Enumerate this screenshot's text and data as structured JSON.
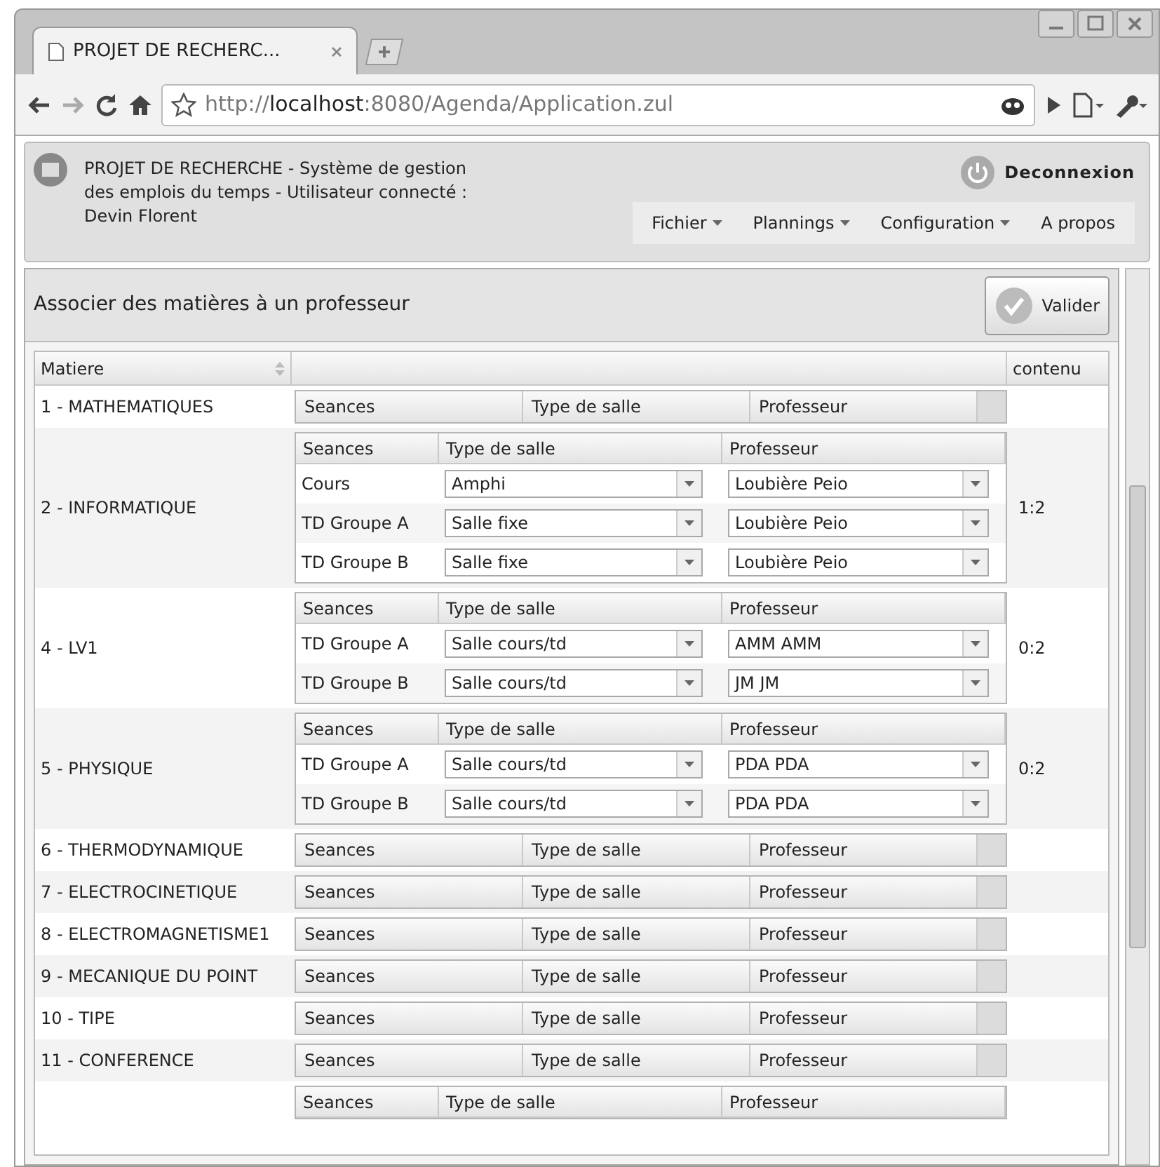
{
  "browser": {
    "tab_title": "PROJET DE RECHERC...",
    "url": "http://**localhost**:8080/Agenda/Application.zul"
  },
  "header": {
    "title": "PROJET DE RECHERCHE - Système de gestion des emplois du temps - Utilisateur connecté : Devin Florent",
    "logout": "Deconnexion",
    "menu": [
      {
        "label": "Fichier",
        "dropdown": true
      },
      {
        "label": "Plannings",
        "dropdown": true
      },
      {
        "label": "Configuration",
        "dropdown": true
      },
      {
        "label": "A propos",
        "dropdown": false
      }
    ]
  },
  "panel": {
    "title": "Associer des matières à un professeur",
    "submit": "Valider"
  },
  "table": {
    "columns": [
      "Matiere",
      "",
      "contenu"
    ],
    "rows": [
      {
        "name": "1 - MATHEMATIQUES",
        "kind": "empty",
        "header": [
          "Seances",
          "Type de salle",
          "Professeur"
        ],
        "sessions": [],
        "contenu": ""
      },
      {
        "name": "2 - INFORMATIQUE",
        "kind": "filled",
        "header": [
          "Seances",
          "Type de salle",
          "Professeur"
        ],
        "sessions": [
          {
            "seance": "Cours",
            "room": "Amphi",
            "teacher": "Loubière Peio"
          },
          {
            "seance": "TD Groupe A",
            "room": "Salle fixe",
            "teacher": "Loubière Peio"
          },
          {
            "seance": "TD Groupe B",
            "room": "Salle fixe",
            "teacher": "Loubière Peio"
          }
        ],
        "contenu": "1:2"
      },
      {
        "name": "4 - LV1",
        "kind": "filled",
        "header": [
          "Seances",
          "Type de salle",
          "Professeur"
        ],
        "sessions": [
          {
            "seance": "TD Groupe A",
            "room": "Salle cours/td",
            "teacher": "AMM AMM"
          },
          {
            "seance": "TD Groupe B",
            "room": "Salle cours/td",
            "teacher": "JM JM"
          }
        ],
        "contenu": "0:2"
      },
      {
        "name": "5 - PHYSIQUE",
        "kind": "filled",
        "header": [
          "Seances",
          "Type de salle",
          "Professeur"
        ],
        "sessions": [
          {
            "seance": "TD Groupe A",
            "room": "Salle cours/td",
            "teacher": "PDA PDA"
          },
          {
            "seance": "TD Groupe B",
            "room": "Salle cours/td",
            "teacher": "PDA PDA"
          }
        ],
        "contenu": "0:2"
      },
      {
        "name": "6 - THERMODYNAMIQUE",
        "kind": "empty",
        "header": [
          "Seances",
          "Type de salle",
          "Professeur"
        ],
        "sessions": [],
        "contenu": ""
      },
      {
        "name": "7 - ELECTROCINETIQUE",
        "kind": "empty",
        "header": [
          "Seances",
          "Type de salle",
          "Professeur"
        ],
        "sessions": [],
        "contenu": ""
      },
      {
        "name": "8 - ELECTROMAGNETISME1",
        "kind": "empty",
        "header": [
          "Seances",
          "Type de salle",
          "Professeur"
        ],
        "sessions": [],
        "contenu": ""
      },
      {
        "name": "9 - MECANIQUE DU POINT",
        "kind": "empty",
        "header": [
          "Seances",
          "Type de salle",
          "Professeur"
        ],
        "sessions": [],
        "contenu": ""
      },
      {
        "name": "10 - TIPE",
        "kind": "empty",
        "header": [
          "Seances",
          "Type de salle",
          "Professeur"
        ],
        "sessions": [],
        "contenu": ""
      },
      {
        "name": "11 - CONFERENCE",
        "kind": "empty",
        "header": [
          "Seances",
          "Type de salle",
          "Professeur"
        ],
        "sessions": [],
        "contenu": ""
      },
      {
        "name": "",
        "kind": "filled",
        "header": [
          "Seances",
          "Type de salle",
          "Professeur"
        ],
        "sessions": [],
        "contenu": ""
      }
    ]
  }
}
